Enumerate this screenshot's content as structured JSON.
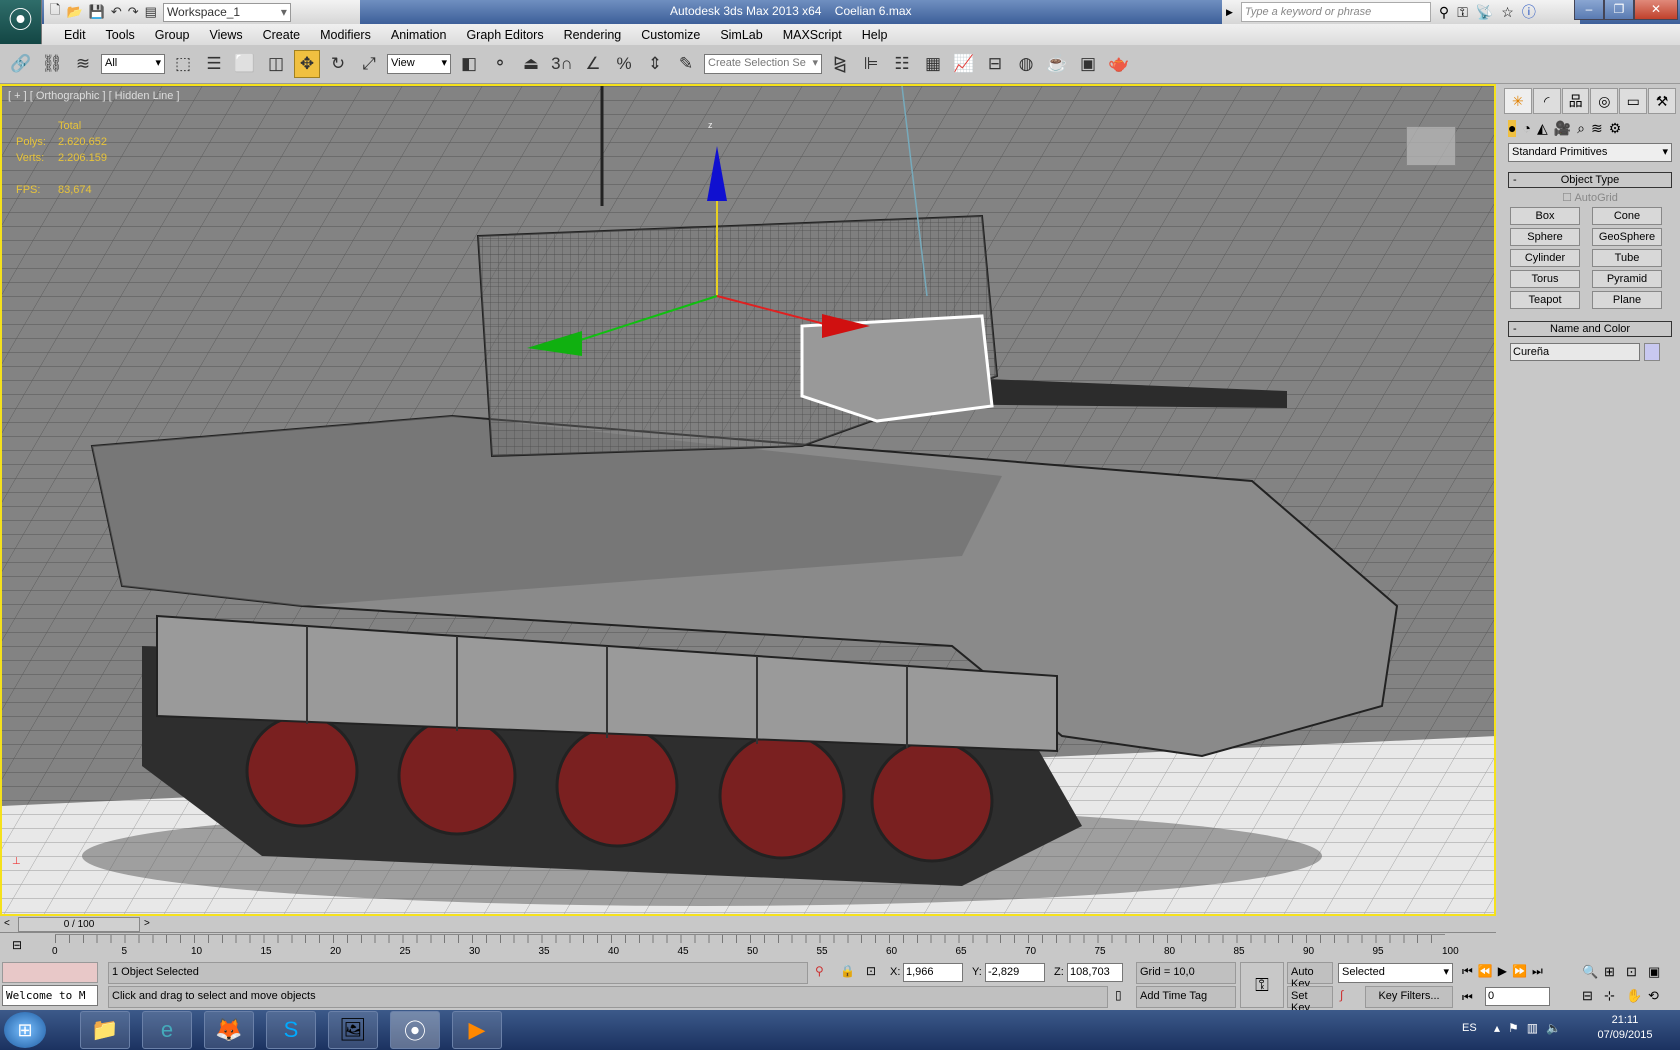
{
  "title_bar": {
    "app_title": "Autodesk 3ds Max  2013 x64",
    "file_name": "Coelian 6.max",
    "workspace": "Workspace_1",
    "search_placeholder": "Type a keyword or phrase",
    "window_buttons": [
      "–",
      "❐",
      "✕"
    ]
  },
  "menu": [
    "Edit",
    "Tools",
    "Group",
    "Views",
    "Create",
    "Modifiers",
    "Animation",
    "Graph Editors",
    "Rendering",
    "Customize",
    "SimLab",
    "MAXScript",
    "Help"
  ],
  "toolbar": {
    "selection_filter": "All",
    "ref_coord": "View",
    "named_selection_placeholder": "Create Selection Se",
    "snap_label": "3",
    "percent_label": "%"
  },
  "viewport": {
    "label": "[ + ] [ Orthographic ] [ Hidden Line ]",
    "stats": {
      "header": "Total",
      "polys_label": "Polys:",
      "polys": "2.620.652",
      "verts_label": "Verts:",
      "verts": "2.206.159",
      "fps_label": "FPS:",
      "fps": "83,674"
    },
    "gizmo_axis_z": "z",
    "accent": "#f5e11b"
  },
  "command_panel": {
    "category": "Standard Primitives",
    "object_type_title": "Object Type",
    "autogrid": "AutoGrid",
    "buttons": [
      "Box",
      "Cone",
      "Sphere",
      "GeoSphere",
      "Cylinder",
      "Tube",
      "Torus",
      "Pyramid",
      "Teapot",
      "Plane"
    ],
    "name_color_title": "Name and Color",
    "object_name": "Cureña",
    "object_color": "#c8c8f0"
  },
  "timeline": {
    "frame_display": "0 / 100",
    "ticks": [
      "0",
      "5",
      "10",
      "15",
      "20",
      "25",
      "30",
      "35",
      "40",
      "45",
      "50",
      "55",
      "60",
      "65",
      "70",
      "75",
      "80",
      "85",
      "90",
      "95",
      "100"
    ]
  },
  "status": {
    "listener": "Welcome to M",
    "selection": "1 Object Selected",
    "prompt": "Click and drag to select and move objects",
    "x_label": "X:",
    "x": "1,966",
    "y_label": "Y:",
    "y": "-2,829",
    "z_label": "Z:",
    "z": "108,703",
    "grid": "Grid = 10,0",
    "add_time_tag": "Add Time Tag",
    "auto_key": "Auto Key",
    "set_key": "Set Key",
    "key_mode": "Selected",
    "key_filters": "Key Filters...",
    "current_frame": "0"
  },
  "taskbar": {
    "language": "ES",
    "time": "21:11",
    "date": "07/09/2015"
  }
}
